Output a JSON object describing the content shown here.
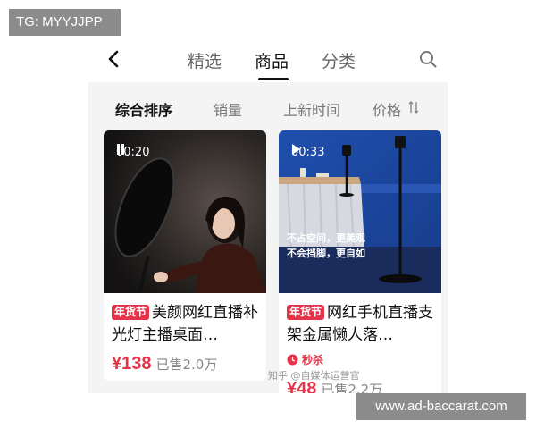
{
  "watermark_top": "TG: MYYJJPP",
  "watermark_bottom": "www.ad-baccarat.com",
  "watermark_zhihu": "知乎 @自媒体运营官",
  "nav": {
    "tabs": [
      "精选",
      "商品",
      "分类"
    ],
    "active_tab": "商品",
    "back_icon": "chevron-left-icon",
    "search_icon": "search-icon"
  },
  "sort": {
    "options": [
      "综合排序",
      "销量",
      "上新时间",
      "价格"
    ],
    "active": "综合排序",
    "sort_icon": "sort-arrows-icon"
  },
  "products": [
    {
      "video_time": "00:20",
      "video_state": "pause",
      "badge": "年货节",
      "title": "美颜网红直播补光灯主播桌面…",
      "price": "¥138",
      "sold": "已售2.0万"
    },
    {
      "video_time": "00:33",
      "video_state": "play",
      "overlay_line1": "不占空间，更美观",
      "overlay_line2": "不会挡脚，更自如",
      "badge": "年货节",
      "title": "网红手机直播支架金属懒人落…",
      "flash_label": "秒杀",
      "price": "¥48",
      "sold": "已售2.2万"
    }
  ],
  "colors": {
    "accent": "#e5344a",
    "background": "#f4f4f4"
  }
}
